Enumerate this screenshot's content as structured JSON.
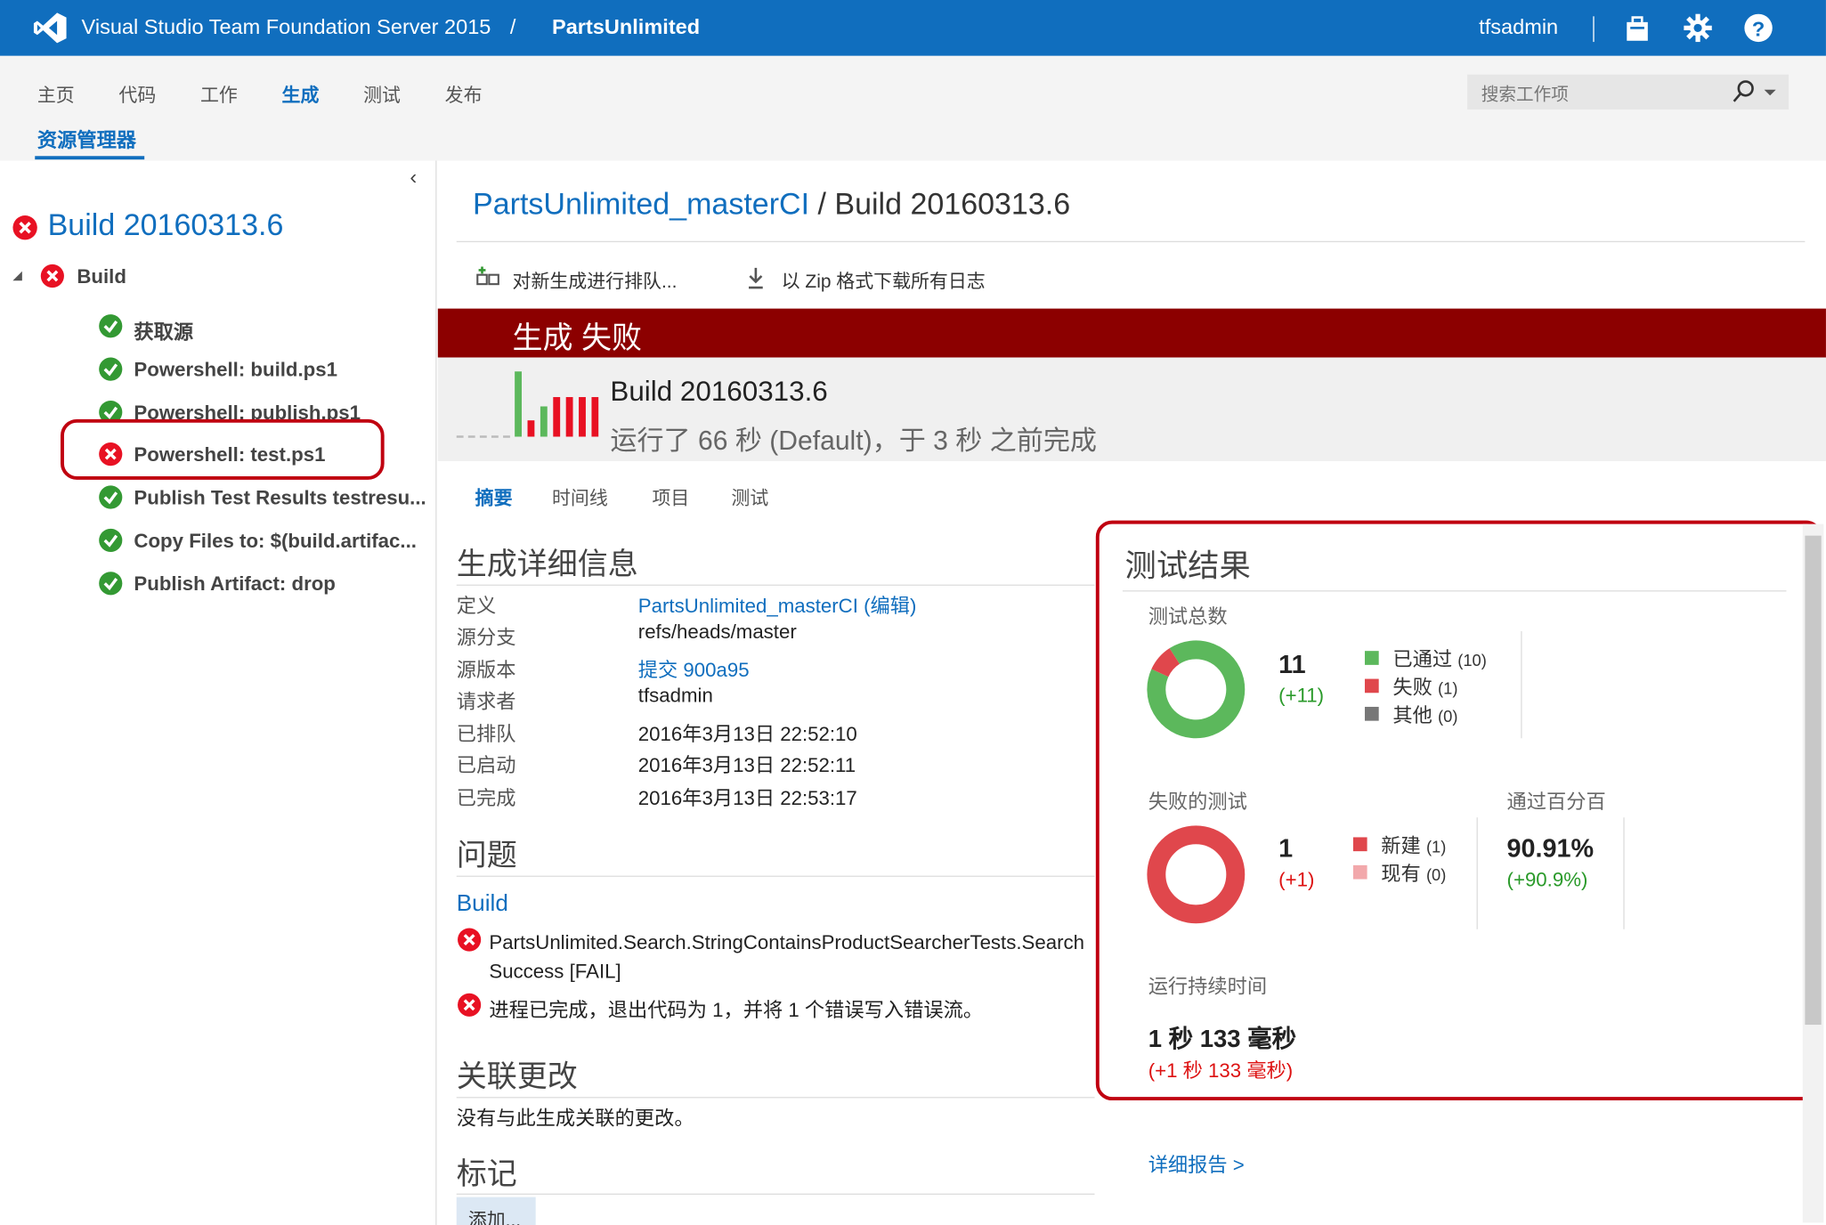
{
  "header": {
    "app_title": "Visual Studio Team Foundation Server 2015",
    "separator": "/",
    "project": "PartsUnlimited",
    "user": "tfsadmin",
    "brand_color": "#106ebe"
  },
  "nav": {
    "items": [
      "主页",
      "代码",
      "工作",
      "生成",
      "测试",
      "发布"
    ],
    "active": "生成",
    "sub_item": "资源管理器",
    "search_placeholder": "搜索工作项"
  },
  "tree": {
    "title": "Build 20160313.6",
    "root": "Build",
    "steps": [
      {
        "label": "获取源",
        "status": "success"
      },
      {
        "label": "Powershell: build.ps1",
        "status": "success"
      },
      {
        "label": "Powershell: publish.ps1",
        "status": "success"
      },
      {
        "label": "Powershell: test.ps1",
        "status": "failed"
      },
      {
        "label": "Publish Test Results testresu...",
        "status": "success"
      },
      {
        "label": "Copy Files to: $(build.artifac...",
        "status": "success"
      },
      {
        "label": "Publish Artifact: drop",
        "status": "success"
      }
    ]
  },
  "main": {
    "definition_link": "PartsUnlimited_masterCI",
    "build_crumb": " / Build 20160313.6",
    "toolbar": {
      "queue": "对新生成进行排队...",
      "download": "以 Zip 格式下载所有日志"
    },
    "status_banner": "生成 失败",
    "build_name": "Build 20160313.6",
    "build_sub": "运行了 66 秒 (Default)，于 3 秒 之前完成",
    "tabs": [
      "摘要",
      "时间线",
      "项目",
      "测试"
    ],
    "details_title": "生成详细信息",
    "details": [
      {
        "label": "定义",
        "value": "PartsUnlimited_masterCI (编辑)",
        "link": true
      },
      {
        "label": "源分支",
        "value": "refs/heads/master",
        "link": false
      },
      {
        "label": "源版本",
        "value": "提交 900a95",
        "link": true
      },
      {
        "label": "请求者",
        "value": "tfsadmin",
        "link": false
      },
      {
        "label": "已排队",
        "value": "2016年3月13日 22:52:10",
        "link": false
      },
      {
        "label": "已启动",
        "value": "2016年3月13日 22:52:11",
        "link": false
      },
      {
        "label": "已完成",
        "value": "2016年3月13日 22:53:17",
        "link": false
      }
    ],
    "issues_title": "问题",
    "issues_group": "Build",
    "issues": [
      "PartsUnlimited.Search.StringContainsProductSearcherTests.SearchSuccess [FAIL]",
      "进程已完成，退出代码为 1，并将 1 个错误写入错误流。"
    ],
    "changes_title": "关联更改",
    "changes_text": "没有与此生成关联的更改。",
    "tags_title": "标记",
    "add_button": "添加..."
  },
  "test_results": {
    "title": "测试结果",
    "total_label": "测试总数",
    "total": "11",
    "total_delta": "(+11)",
    "legend_total": [
      {
        "label": "已通过",
        "count": "(10)",
        "color": "#5cb85c"
      },
      {
        "label": "失败",
        "count": "(1)",
        "color": "#e0474c"
      },
      {
        "label": "其他",
        "count": "(0)",
        "color": "#777777"
      }
    ],
    "failed_label": "失败的测试",
    "failed": "1",
    "failed_delta": "(+1)",
    "legend_failed": [
      {
        "label": "新建",
        "count": "(1)",
        "color": "#e0474c"
      },
      {
        "label": "现有",
        "count": "(0)",
        "color": "#f2a8ab"
      }
    ],
    "pass_pct_label": "通过百分百",
    "pass_pct": "90.91%",
    "pass_pct_delta": "(+90.9%)",
    "duration_label": "运行持续时间",
    "duration": "1 秒 133 毫秒",
    "duration_delta": "(+1 秒 133 毫秒)",
    "detail_link": "详细报告 >"
  },
  "chart_data": [
    {
      "type": "pie",
      "title": "测试总数",
      "categories": [
        "已通过",
        "失败",
        "其他"
      ],
      "values": [
        10,
        1,
        0
      ]
    },
    {
      "type": "pie",
      "title": "失败的测试",
      "categories": [
        "新建",
        "现有"
      ],
      "values": [
        1,
        0
      ]
    }
  ]
}
